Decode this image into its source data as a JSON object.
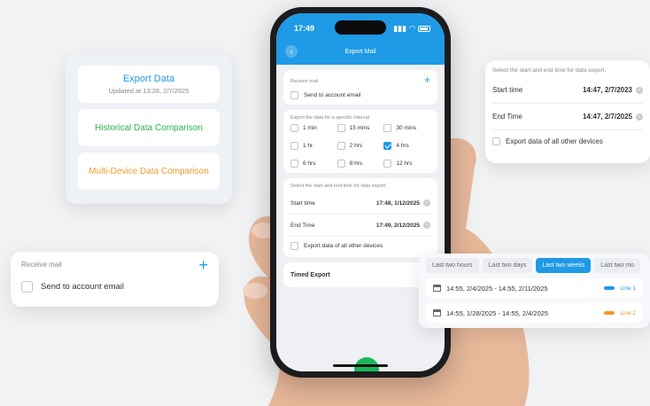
{
  "phone": {
    "time": "17:49",
    "nav_title": "Export Mail",
    "receive_mail_label": "Receive mail",
    "send_to_account": "Send to account email",
    "interval_title": "Export the data for a specific interval",
    "interval_options": [
      {
        "label": "1 min",
        "checked": false
      },
      {
        "label": "15 mins",
        "checked": false
      },
      {
        "label": "30 mins",
        "checked": false
      },
      {
        "label": "1 hr",
        "checked": false
      },
      {
        "label": "2 hrs",
        "checked": false
      },
      {
        "label": "4 hrs",
        "checked": true
      },
      {
        "label": "6 hrs",
        "checked": false
      },
      {
        "label": "8 hrs",
        "checked": false
      },
      {
        "label": "12 hrs",
        "checked": false
      }
    ],
    "range_title": "Select the start and end time for data export.",
    "start_label": "Start time",
    "start_value": "17:48,  1/12/2025",
    "end_label": "End Time",
    "end_value": "17:49,  2/12/2025",
    "other_devices": "Export data of all other devices",
    "timed_export": "Timed Export"
  },
  "menu_card": {
    "export_data": "Export Data",
    "updated": "Updated at 13:28,  2/7/2025",
    "historical": "Historical Data Comparison",
    "multi_device": "Multi-Device Data Comparison"
  },
  "mail_card": {
    "receive_mail_label": "Receive mail",
    "send_to_account": "Send to account email"
  },
  "time_card": {
    "title": "Select the start and end time for data export.",
    "start_label": "Start time",
    "start_value": "14:47,  2/7/2023",
    "end_label": "End Time",
    "end_value": "14:47,  2/7/2025",
    "other_devices": "Export data of all other devices"
  },
  "range_card": {
    "tabs": [
      {
        "label": "Last two hours",
        "active": false
      },
      {
        "label": "Last two days",
        "active": false
      },
      {
        "label": "Last two weeks",
        "active": true
      },
      {
        "label": "Last two mo",
        "active": false
      }
    ],
    "records": [
      {
        "range": "14:55,  2/4/2025 - 14:55,  2/11/2025",
        "line": "Line 1",
        "color": "#1e9ae6"
      },
      {
        "range": "14:55,  1/28/2025 - 14:55,  2/4/2025",
        "line": "Line 2",
        "color": "#f29a2e"
      }
    ]
  },
  "colors": {
    "accent": "#1e9ae6",
    "green": "#2bb44a",
    "orange": "#f29a2e"
  }
}
